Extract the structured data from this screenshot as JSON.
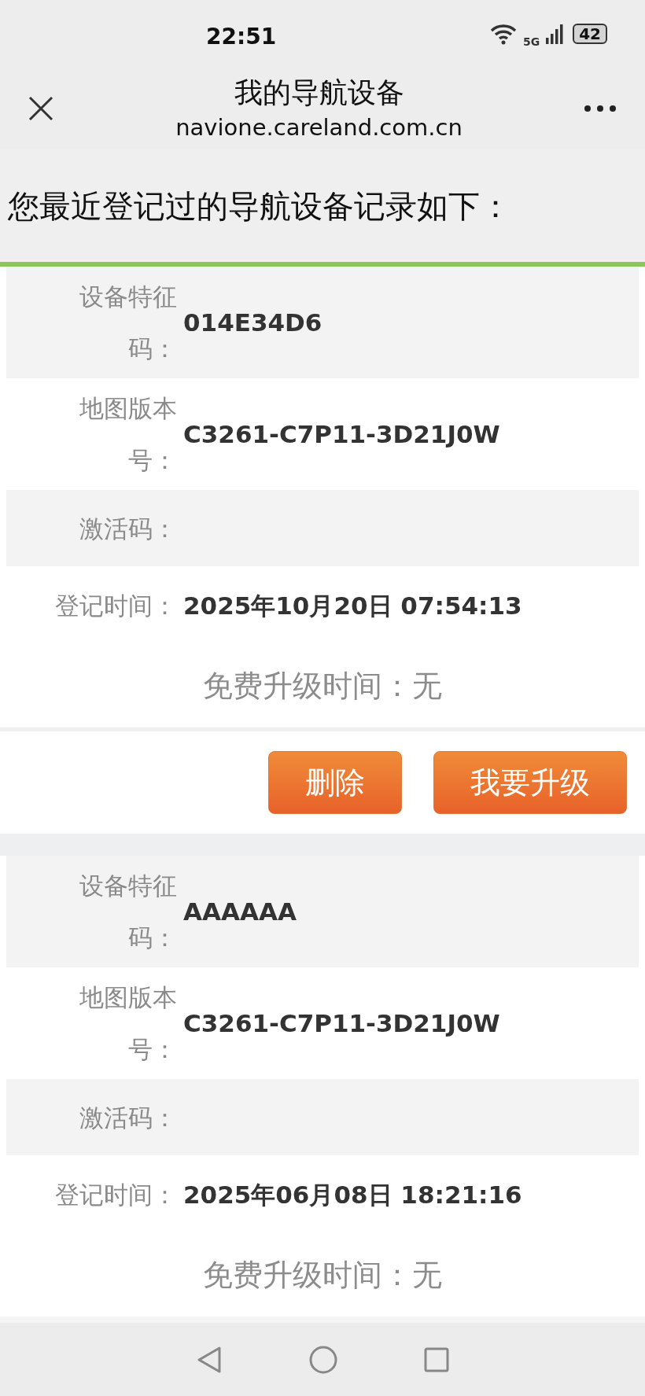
{
  "status_bar": {
    "time": "22:51",
    "network": "5G",
    "battery": "42"
  },
  "header": {
    "title": "我的导航设备",
    "url": "navione.careland.com.cn"
  },
  "intro": "您最近登记过的导航设备记录如下：",
  "records": [
    {
      "fields": [
        {
          "kind": "field",
          "label": "设备特征码：",
          "value": "014E34D6"
        },
        {
          "kind": "field",
          "label": "地图版本号：",
          "value": "C3261-C7P11-3D21J0W"
        },
        {
          "kind": "field",
          "label": "激活码："
        },
        {
          "kind": "timestamp",
          "label": "登记时间：",
          "value": "2025年10月20日 07:54:13"
        }
      ],
      "free_upgrade": "免费升级时间：无",
      "buttons": [
        {
          "label": "删除"
        },
        {
          "label": "我要升级"
        }
      ]
    },
    {
      "fields": [
        {
          "kind": "field",
          "label": "设备特征码：",
          "value": "AAAAAA"
        },
        {
          "kind": "field",
          "label": "地图版本号：",
          "value": "C3261-C7P11-3D21J0W"
        },
        {
          "kind": "field",
          "label": "激活码："
        },
        {
          "kind": "timestamp",
          "label": "登记时间：",
          "value": "2025年06月08日 18:21:16"
        }
      ],
      "free_upgrade": "免费升级时间：无"
    }
  ]
}
